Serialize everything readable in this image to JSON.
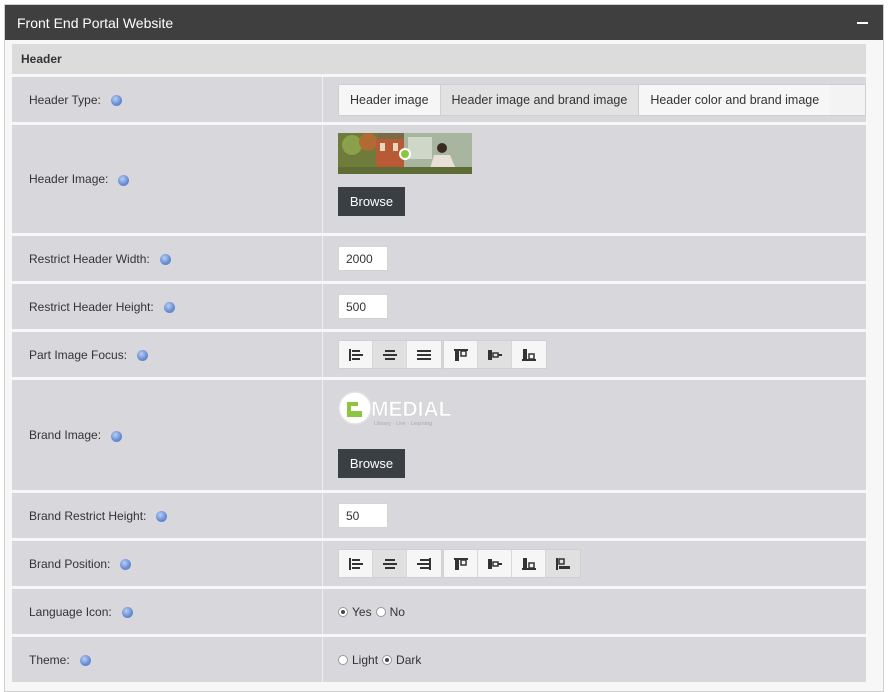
{
  "panel": {
    "title": "Front End Portal Website"
  },
  "section": {
    "title": "Header"
  },
  "rows": {
    "header_type": {
      "label": "Header Type:",
      "options": [
        "Header image",
        "Header image and brand image",
        "Header color and brand image"
      ],
      "selected": "Header image and brand image"
    },
    "header_image": {
      "label": "Header Image:",
      "browse": "Browse"
    },
    "restrict_width": {
      "label": "Restrict Header Width:",
      "value": "2000"
    },
    "restrict_height": {
      "label": "Restrict Header Height:",
      "value": "500"
    },
    "image_focus": {
      "label": "Part Image Focus:"
    },
    "brand_image": {
      "label": "Brand Image:",
      "logo_text": "MEDIAL",
      "logo_tagline": "Library · Live · Learning",
      "browse": "Browse"
    },
    "brand_height": {
      "label": "Brand Restrict Height:",
      "value": "50"
    },
    "brand_position": {
      "label": "Brand Position:"
    },
    "language_icon": {
      "label": "Language Icon:",
      "yes": "Yes",
      "no": "No",
      "selected": "Yes"
    },
    "theme": {
      "label": "Theme:",
      "light": "Light",
      "dark": "Dark",
      "selected": "Dark"
    }
  },
  "colors": {
    "titlebar": "#3f3f3f",
    "row": "#d8d8dc",
    "button": "#3a3f44",
    "logo_green": "#8cc63f"
  }
}
